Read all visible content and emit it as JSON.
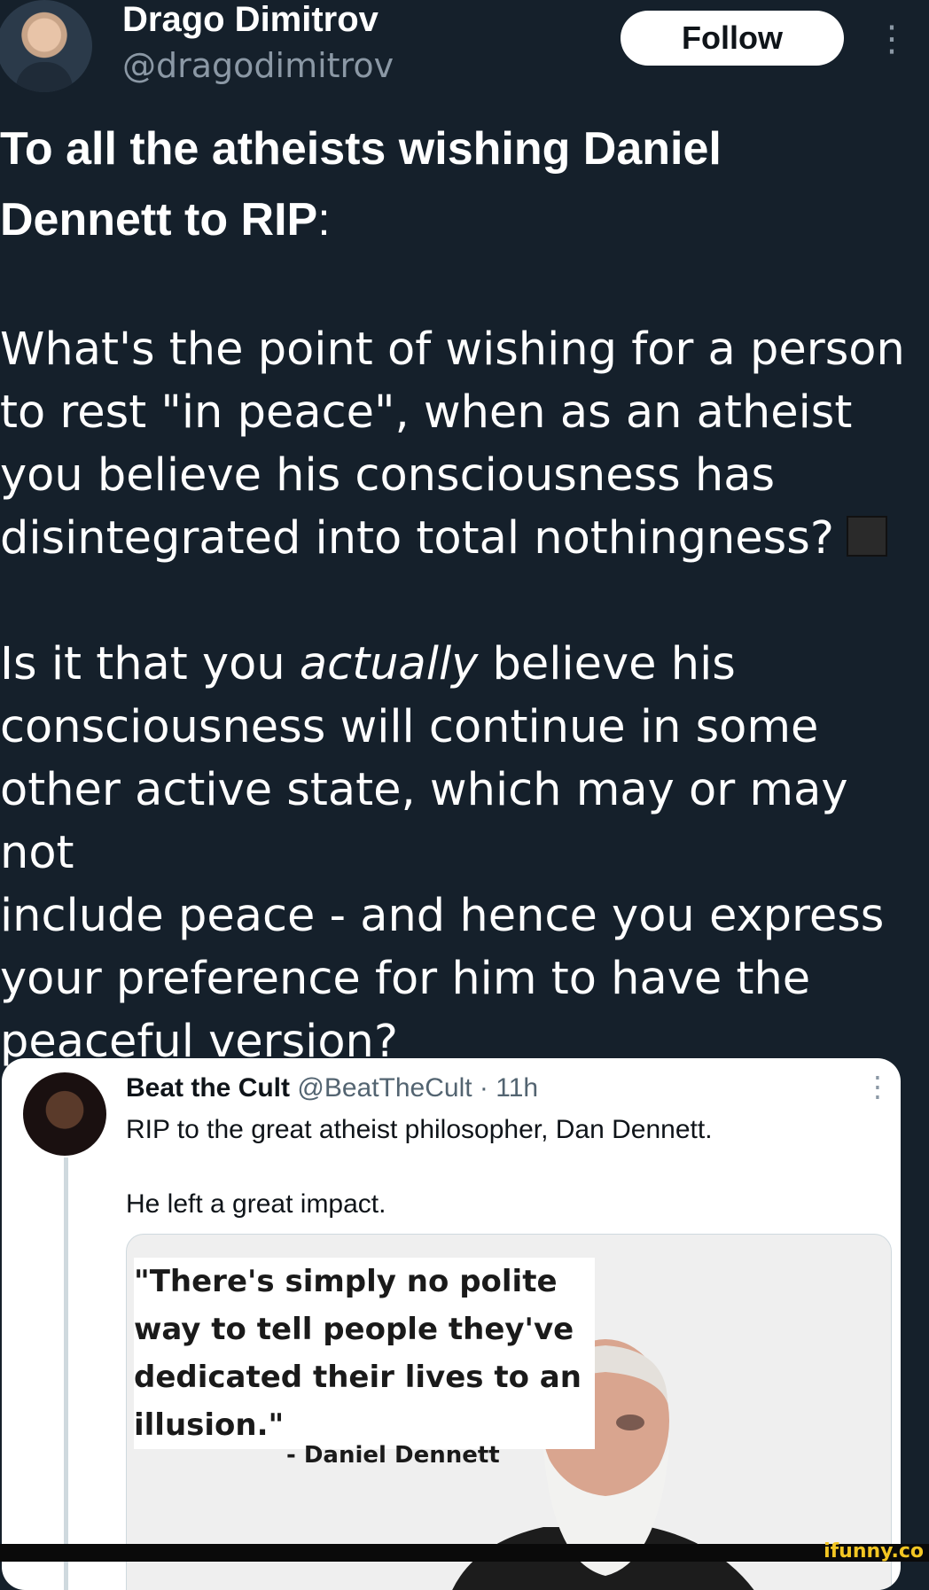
{
  "author": {
    "name": "Drago Dimitrov",
    "handle": "@dragodimitrov"
  },
  "follow_label": "Follow",
  "tweet": {
    "headline_line1": "To all the atheists wishing Daniel",
    "headline_line2_bold": "Dennett to RIP",
    "headline_line2_tail": ":",
    "para1": [
      "What's the point of wishing for a person",
      "to rest \"in peace\", when as an atheist",
      "you believe his consciousness has",
      "disintegrated into total nothingness?"
    ],
    "para2_line1_pre": "Is it that you ",
    "para2_line1_em": "actually",
    "para2_line1_post": " believe his",
    "para2_rest": [
      "consciousness will continue in some",
      "other active state, which may or may not",
      "include peace - and hence you express",
      "your preference for him to have the",
      "peaceful version?"
    ]
  },
  "quoted": {
    "name": "Beat the Cult",
    "handle": "@BeatTheCult",
    "separator": "·",
    "time": "11h",
    "text1": "RIP to the great atheist philosopher, Dan Dennett.",
    "text2": "He left a great impact.",
    "image_quote_lines": [
      "\"There's simply no polite",
      "way to tell people they've",
      "dedicated their lives to an",
      "illusion.\""
    ],
    "image_attribution": "- Daniel Dennett"
  },
  "watermark": "ifunny.co",
  "colors": {
    "background": "#15202b",
    "secondary_text": "#8b98a5",
    "card_background": "#ffffff"
  }
}
